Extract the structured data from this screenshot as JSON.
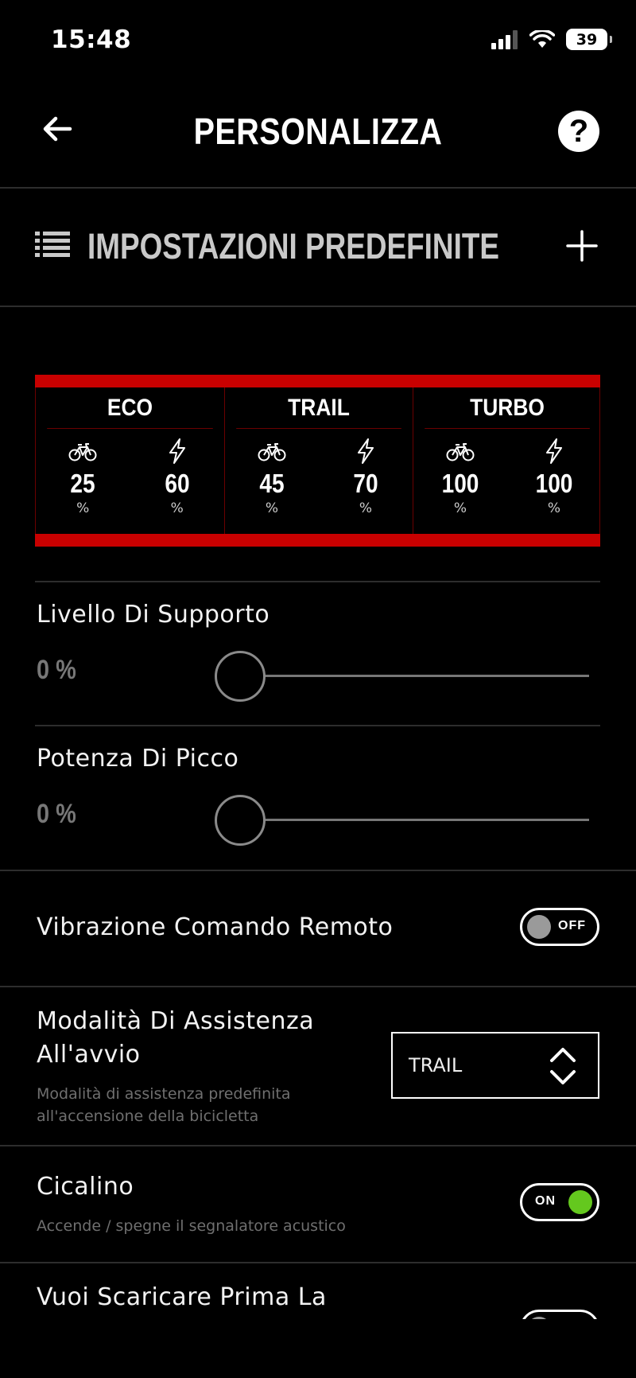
{
  "status_bar": {
    "time": "15:48",
    "battery": "39"
  },
  "nav": {
    "title": "PERSONALIZZA",
    "help_label": "?"
  },
  "presets": {
    "label": "IMPOSTAZIONI PREDEFINITE"
  },
  "modes": [
    {
      "name": "ECO",
      "support": "25",
      "peak": "60",
      "unit": "%"
    },
    {
      "name": "TRAIL",
      "support": "45",
      "peak": "70",
      "unit": "%"
    },
    {
      "name": "TURBO",
      "support": "100",
      "peak": "100",
      "unit": "%"
    }
  ],
  "sliders": {
    "support": {
      "label": "Livello Di Supporto",
      "value_text": "0 %",
      "value": 0
    },
    "peak": {
      "label": "Potenza Di Picco",
      "value_text": "0 %",
      "value": 0
    }
  },
  "settings": {
    "vibration": {
      "label": "Vibrazione Comando Remoto",
      "state": "OFF"
    },
    "startup_mode": {
      "label_line1": "Modalità Di Assistenza",
      "label_line2": "All'avvio",
      "sub_line1": "Modalità di assistenza predefinita",
      "sub_line2": "all'accensione della bicicletta",
      "selected": "TRAIL"
    },
    "buzzer": {
      "label": "Cicalino",
      "sub": "Accende / spegne il segnalatore acustico",
      "state": "ON"
    },
    "discharge": {
      "label": "Vuoi Scaricare Prima La"
    }
  },
  "colors": {
    "accent_red": "#c80000",
    "toggle_on": "#64c81e"
  }
}
